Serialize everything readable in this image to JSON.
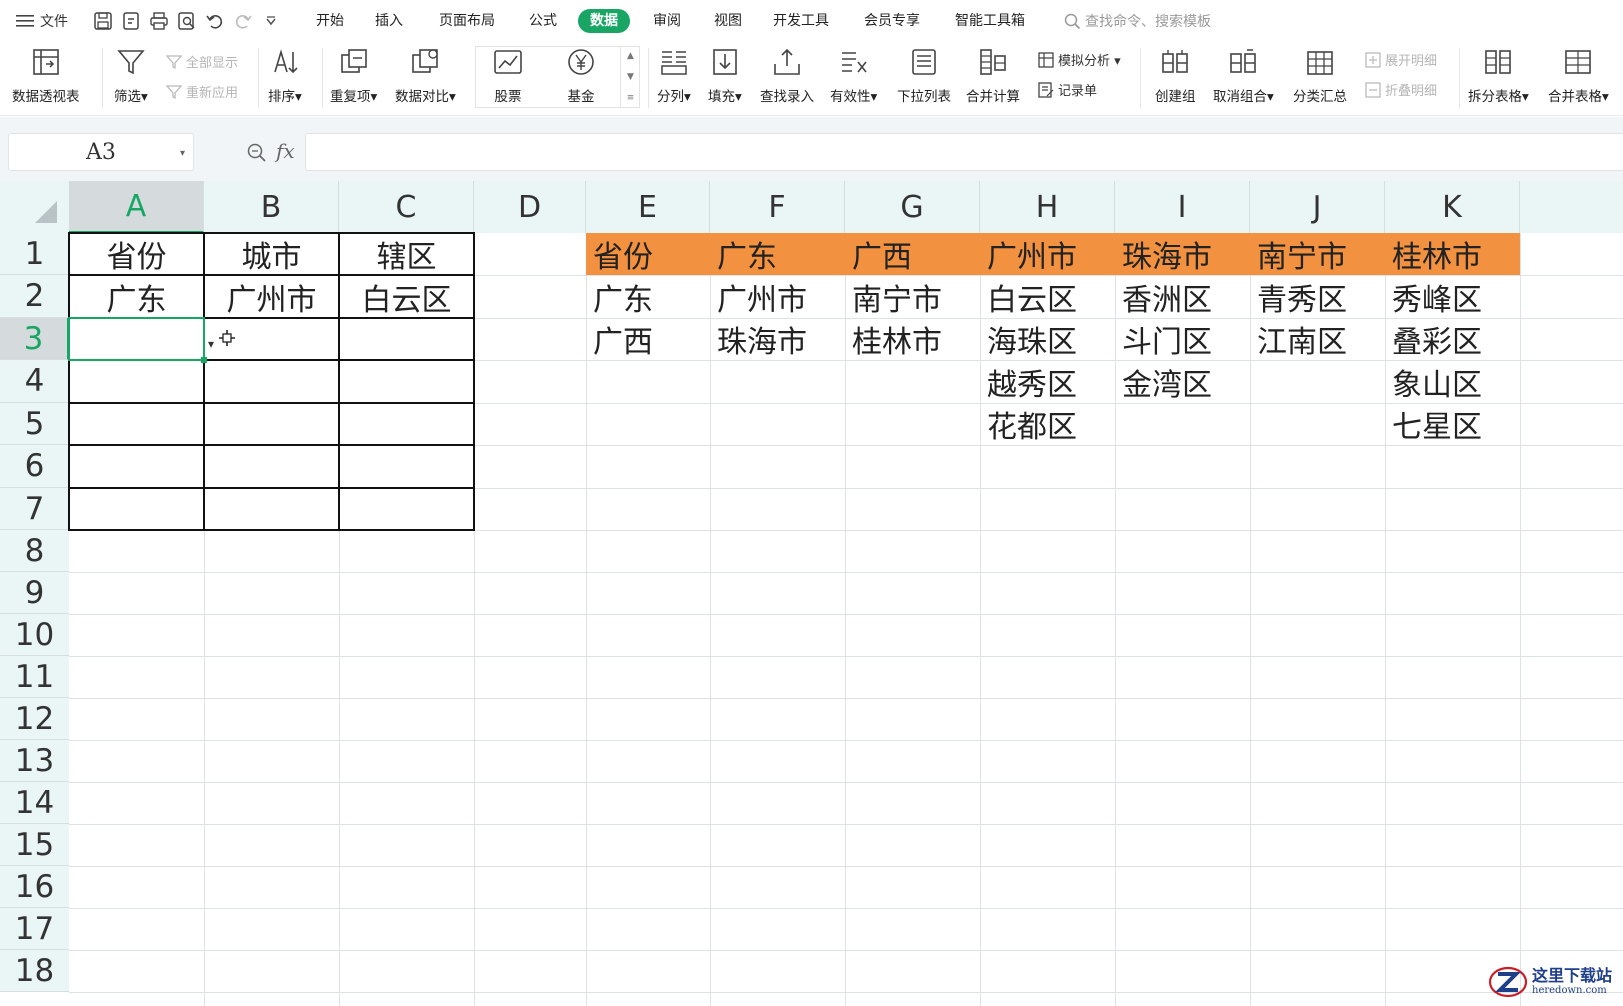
{
  "menubar": {
    "file_label": "文件",
    "tabs": [
      "开始",
      "插入",
      "页面布局",
      "公式",
      "数据",
      "审阅",
      "视图",
      "开发工具",
      "会员专享",
      "智能工具箱"
    ],
    "active_tab": "数据",
    "search_placeholder": "查找命令、搜索模板"
  },
  "ribbon": {
    "pivot": "数据透视表",
    "filter": "筛选",
    "show_all": "全部显示",
    "reapply": "重新应用",
    "sort": "排序",
    "duplicates": "重复项",
    "compare": "数据对比",
    "stock": "股票",
    "fund": "基金",
    "split": "分列",
    "fill": "填充",
    "lookup": "查找录入",
    "validity": "有效性",
    "dropdown_list": "下拉列表",
    "consolidate": "合并计算",
    "what_if": "模拟分析",
    "record_form": "记录单",
    "create_group": "创建组",
    "ungroup": "取消组合",
    "subtotal": "分类汇总",
    "expand_detail": "展开明细",
    "collapse_detail": "折叠明细",
    "split_table": "拆分表格",
    "merge_table": "合并表格"
  },
  "formula_bar": {
    "name_box": "A3",
    "fx_label": "fx",
    "formula": ""
  },
  "sheet": {
    "columns": [
      "A",
      "B",
      "C",
      "D",
      "E",
      "F",
      "G",
      "H",
      "I",
      "J",
      "K"
    ],
    "selected_column": "A",
    "rows": [
      "1",
      "2",
      "3",
      "4",
      "5",
      "6",
      "7",
      "8",
      "9",
      "10",
      "11",
      "12",
      "13",
      "14",
      "15",
      "16",
      "17",
      "18"
    ],
    "selected_row": "3",
    "active_cell": "A3",
    "left_table": {
      "header": [
        "省份",
        "城市",
        "辖区"
      ],
      "row2": [
        "广东",
        "广州市",
        "白云区"
      ]
    },
    "right_table": {
      "header": [
        "省份",
        "广东",
        "广西",
        "广州市",
        "珠海市",
        "南宁市",
        "桂林市"
      ],
      "rows": [
        [
          "广东",
          "广州市",
          "南宁市",
          "白云区",
          "香洲区",
          "青秀区",
          "秀峰区"
        ],
        [
          "广西",
          "珠海市",
          "桂林市",
          "海珠区",
          "斗门区",
          "江南区",
          "叠彩区"
        ],
        [
          "",
          "",
          "",
          "越秀区",
          "金湾区",
          "",
          "象山区"
        ],
        [
          "",
          "",
          "",
          "花都区",
          "",
          "",
          "七星区"
        ]
      ],
      "header_color": "#f2913f"
    }
  },
  "accent_color": "#19a665",
  "watermark": {
    "cn": "这里下载站",
    "en": "heredown.com"
  }
}
